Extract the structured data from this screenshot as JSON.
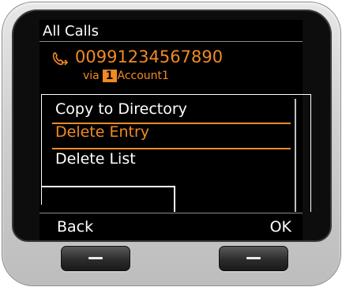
{
  "screen": {
    "title": "All Calls",
    "entry": {
      "number": "00991234567890",
      "via_label": "via",
      "account_number": "1",
      "account_name": "Account1",
      "icon": "call-log-phone-icon"
    },
    "menu": {
      "items": [
        {
          "label": "Copy to Directory",
          "selected": false
        },
        {
          "label": "Delete Entry",
          "selected": true
        },
        {
          "label": "Delete List",
          "selected": false
        }
      ]
    },
    "softkeys": {
      "left": "Back",
      "right": "OK"
    }
  },
  "colors": {
    "accent": "#f08a24",
    "screen_bg": "#000000",
    "text": "#ffffff"
  }
}
